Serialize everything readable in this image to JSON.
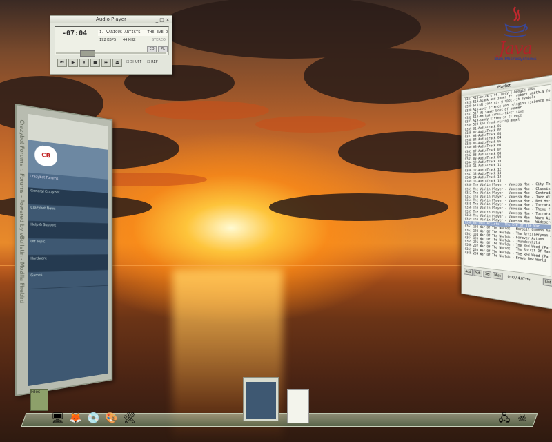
{
  "desktop": {
    "java_logo_word": "Java",
    "java_logo_sub": "Sun Microsystems"
  },
  "player": {
    "title": "Audio Player",
    "time": "-07:04",
    "song": "1. VARIOUS ARTISTS - THE EVE OF",
    "kbps": "192 KBPS",
    "khz": "44 KHZ",
    "mode": "STEREO",
    "shuffle_label": "SHUFF",
    "repeat_label": "REP",
    "eq_label": "EQ",
    "pl_label": "PL",
    "seek_fraction": 0.25
  },
  "browser": {
    "side_title": "Crazybot Forums :: Forums - Powered by vBulletin - Mozilla Firebird",
    "logo_text": "CB",
    "forum_bar": "Crazybot Forums",
    "rows": [
      "General Crazybot",
      "Crazybot News",
      "Help & Support",
      "Off Topic",
      "Hardware",
      "Games"
    ]
  },
  "playlist": {
    "title": "Playlist",
    "items": [
      "0327 513-erick e ft. grey j-boogie down",
      "0328 514-blank and jones ft. robert smith-a forrest",
      "0329 515-dj jose vs. g spott-it symbols",
      "0330 516-zoey-science and religion (science mix)",
      "0331 517-dj sammy-boys of summer",
      "0332 518-markus schulz-first time",
      "0333 519-sandy kitten-in silence",
      "0334 520-the freak-rising angel",
      "0335 01-AudioTrack 01",
      "0336 02-AudioTrack 02",
      "0337 03-AudioTrack 03",
      "0338 04-AudioTrack 04",
      "0339 05-AudioTrack 05",
      "0340 06-AudioTrack 06",
      "0341 07-AudioTrack 07",
      "0342 08-AudioTrack 08",
      "0343 09-AudioTrack 09",
      "0344 10-AudioTrack 10",
      "0345 11-AudioTrack 11",
      "0346 12-AudioTrack 12",
      "0347 13-AudioTrack 13",
      "0348 14-AudioTrack 14",
      "0349 15-AudioTrack 15",
      "0350 The Violin Player - Vanessa Mae - City Theme",
      "0351 The Violin Player - Vanessa Mae - Classical Gas",
      "0352 The Violin Player - Vanessa Mae - Contradanza",
      "0353 The Violin Player - Vanessa Mae - Jazz Will Eat It",
      "0354 The Violin Player - Vanessa Mae - Red Hot",
      "0355 The Violin Player - Vanessa Mae - Toccata Mecha",
      "0356 The Violin Player - Vanessa Mae - Theme from 'C",
      "0357 The Violin Player - Vanessa Mae - Toccata and Fu",
      "0358 The Violin Player - Vanessa Mae - Warm Air",
      "0359 The Violin Player - Vanessa Mae - Widescreen",
      "0360 Various Artists - The Eve Of The War",
      "0361 102 War Of The Worlds - Horsell Common And Th",
      "0362 103 War Of The Worlds - The Artilleryman And Th",
      "0363 104 War Of The Worlds - Forever Autumn",
      "0364 105 War Of The Worlds - Thunderchild",
      "0365 201 War Of The Worlds - The Red Weed (Part 1)",
      "0366 202 War Of The Worlds - The Spirit Of Man",
      "0367 203 War Of The Worlds - The Red Weed (Part 2)",
      "0368 204 War Of The Worlds - Brave New World"
    ],
    "selected_index": 33,
    "buttons": [
      "Add",
      "Sub",
      "Sel",
      "Misc"
    ],
    "list_label": "List",
    "time_readout": "0:00 / 4:07:36"
  },
  "dock": {
    "folder_label": "Files"
  }
}
